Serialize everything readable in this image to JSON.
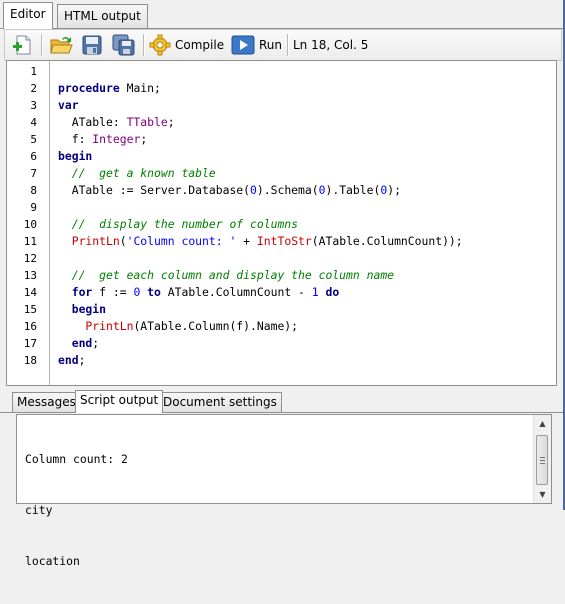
{
  "tabs": [
    {
      "label": "Editor",
      "active": true
    },
    {
      "label": "HTML output",
      "active": false
    }
  ],
  "toolbar": {
    "icons": [
      "new-document-icon",
      "open-folder-icon",
      "save-icon",
      "save-all-icon",
      "gear-icon",
      "run-icon"
    ],
    "compile_label": "Compile",
    "run_label": "Run",
    "status": "Ln 18, Col. 5"
  },
  "editor": {
    "line_numbers": [
      "1",
      "2",
      "3",
      "4",
      "5",
      "6",
      "7",
      "8",
      "9",
      "10",
      "11",
      "12",
      "13",
      "14",
      "15",
      "16",
      "17",
      "18"
    ],
    "lines": [
      [],
      [
        {
          "c": "kw",
          "t": "procedure"
        },
        {
          "c": "",
          "t": " Main;"
        }
      ],
      [
        {
          "c": "kw",
          "t": "var"
        }
      ],
      [
        {
          "c": "",
          "t": "  ATable: "
        },
        {
          "c": "ty",
          "t": "TTable"
        },
        {
          "c": "",
          "t": ";"
        }
      ],
      [
        {
          "c": "",
          "t": "  f: "
        },
        {
          "c": "ty",
          "t": "Integer"
        },
        {
          "c": "",
          "t": ";"
        }
      ],
      [
        {
          "c": "kw",
          "t": "begin"
        }
      ],
      [
        {
          "c": "cm",
          "t": "  //  get a known table"
        }
      ],
      [
        {
          "c": "",
          "t": "  ATable := Server.Database("
        },
        {
          "c": "num",
          "t": "0"
        },
        {
          "c": "",
          "t": ").Schema("
        },
        {
          "c": "num",
          "t": "0"
        },
        {
          "c": "",
          "t": ").Table("
        },
        {
          "c": "num",
          "t": "0"
        },
        {
          "c": "",
          "t": ");"
        }
      ],
      [],
      [
        {
          "c": "cm",
          "t": "  //  display the number of columns"
        }
      ],
      [
        {
          "c": "fn",
          "t": "  PrintLn"
        },
        {
          "c": "",
          "t": "("
        },
        {
          "c": "str",
          "t": "'Column count: '"
        },
        {
          "c": "",
          "t": " + "
        },
        {
          "c": "fn",
          "t": "IntToStr"
        },
        {
          "c": "",
          "t": "(ATable.ColumnCount));"
        }
      ],
      [],
      [
        {
          "c": "cm",
          "t": "  //  get each column and display the column name"
        }
      ],
      [
        {
          "c": "kw",
          "t": "  for"
        },
        {
          "c": "",
          "t": " f := "
        },
        {
          "c": "num",
          "t": "0"
        },
        {
          "c": "kw",
          "t": " to"
        },
        {
          "c": "",
          "t": " ATable.ColumnCount - "
        },
        {
          "c": "num",
          "t": "1"
        },
        {
          "c": "kw",
          "t": " do"
        }
      ],
      [
        {
          "c": "kw",
          "t": "  begin"
        }
      ],
      [
        {
          "c": "fn",
          "t": "    PrintLn"
        },
        {
          "c": "",
          "t": "(ATable.Column(f).Name);"
        }
      ],
      [
        {
          "c": "kw",
          "t": "  end"
        },
        {
          "c": "",
          "t": ";"
        }
      ],
      [
        {
          "c": "kw",
          "t": "end"
        },
        {
          "c": "",
          "t": ";"
        }
      ]
    ]
  },
  "bottom_tabs": [
    {
      "label": "Messages",
      "active": false
    },
    {
      "label": "Script output",
      "active": true
    },
    {
      "label": "Document settings",
      "active": false
    }
  ],
  "output": {
    "lines": [
      "Column count: 2",
      "city",
      "location"
    ]
  }
}
